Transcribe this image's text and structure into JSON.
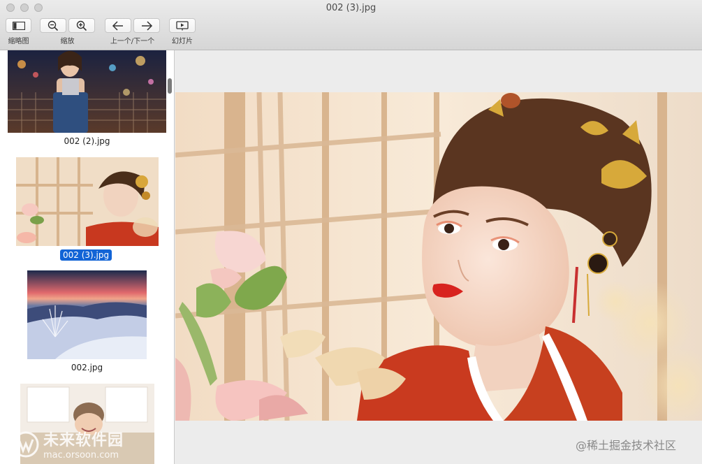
{
  "window": {
    "title": "002 (3).jpg"
  },
  "toolbar": {
    "thumbnails_label": "缩略图",
    "zoom_label": "缩放",
    "nav_label": "上一个/下一个",
    "slideshow_label": "幻灯片"
  },
  "sidebar": {
    "items": [
      {
        "caption": "002 (2).jpg",
        "selected": false
      },
      {
        "caption": "002 (3).jpg",
        "selected": true
      },
      {
        "caption": "002.jpg",
        "selected": false
      },
      {
        "caption": "",
        "selected": false
      }
    ]
  },
  "watermarks": {
    "site_name": "未来软件园",
    "site_url": "mac.orsoon.com",
    "community": "@稀土掘金技术社区"
  },
  "colors": {
    "selection": "#1264d6"
  }
}
